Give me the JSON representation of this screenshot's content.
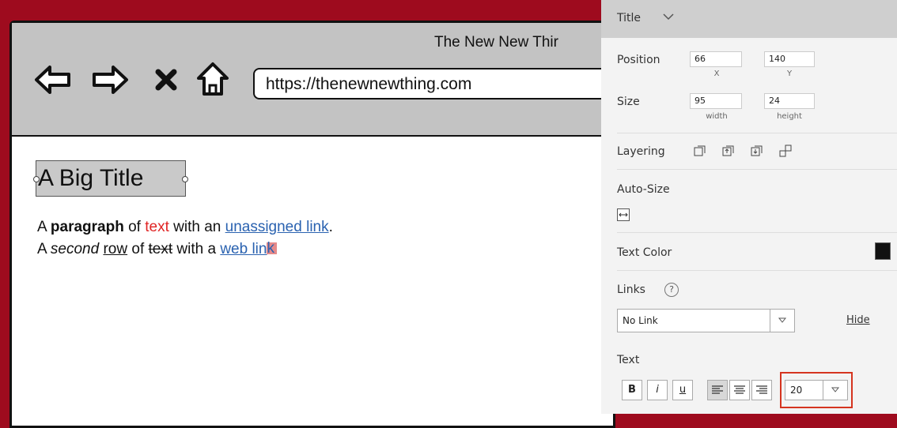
{
  "browser": {
    "page_title": "The New New Thir",
    "url": "https://thenewnewthing.com",
    "icons": [
      "back-arrow-icon",
      "forward-arrow-icon",
      "close-x-icon",
      "home-icon"
    ]
  },
  "canvas": {
    "big_title": "A Big Title",
    "para1": {
      "w1": "A ",
      "bold": "paragraph",
      "w2": " of ",
      "red": "text",
      "w3": " with an ",
      "link": "unassigned link",
      "w4": "."
    },
    "para2": {
      "w1": "A ",
      "italic": "second",
      "w2": " ",
      "underline": "row",
      "w3": " of ",
      "strike": "text",
      "w4": " with a ",
      "link_a": "web lin",
      "link_b": "k"
    },
    "colors": {
      "red_text": "#e02424",
      "link": "#2a62b0"
    }
  },
  "panel": {
    "header": "Title",
    "position": {
      "label": "Position",
      "x": "66",
      "x_label": "X",
      "y": "140",
      "y_label": "Y"
    },
    "size": {
      "label": "Size",
      "width": "95",
      "width_label": "width",
      "height": "24",
      "height_label": "height"
    },
    "layering": {
      "label": "Layering"
    },
    "autosize": {
      "label": "Auto-Size"
    },
    "text_color": {
      "label": "Text Color",
      "value": "#111111"
    },
    "links": {
      "label": "Links",
      "help": "?",
      "selected": "No Link",
      "hide": "Hide"
    },
    "text": {
      "label": "Text",
      "bold": "B",
      "italic": "i",
      "underline": "u",
      "font_size": "20"
    }
  },
  "highlight_color": "#d5341f"
}
